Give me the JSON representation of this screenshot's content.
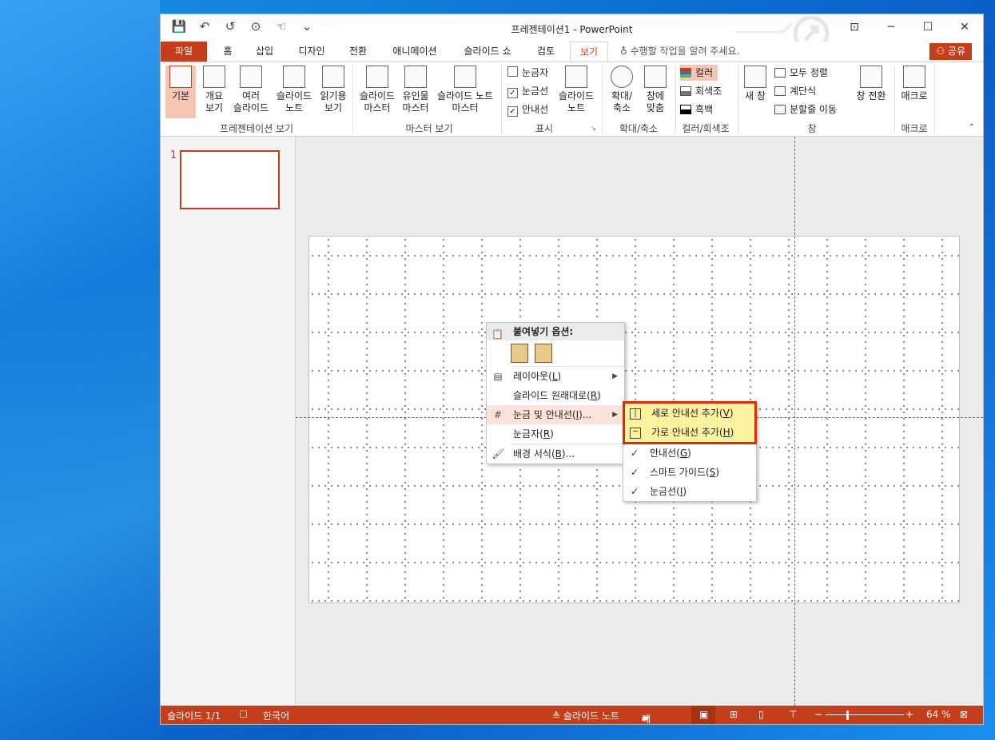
{
  "window": {
    "title": "프레젠테이션1 - PowerPoint"
  },
  "qat": {
    "save": "💾",
    "undo": "↶",
    "redo": "↺",
    "present": "⊙",
    "touch": "☜",
    "customize": "⌄"
  },
  "tabs": [
    {
      "label": "파일"
    },
    {
      "label": "홈"
    },
    {
      "label": "삽입"
    },
    {
      "label": "디자인"
    },
    {
      "label": "전환"
    },
    {
      "label": "애니메이션"
    },
    {
      "label": "슬라이드 쇼"
    },
    {
      "label": "검토"
    },
    {
      "label": "보기"
    }
  ],
  "tellme": "수행할 작업을 알려 주세요.",
  "share": "공유",
  "ribbon": {
    "presentation_views": {
      "label": "프레젠테이션 보기",
      "buttons": [
        "기본",
        "개요\n보기",
        "여러\n슬라이드",
        "슬라이드\n노트",
        "읽기용\n보기"
      ]
    },
    "master_views": {
      "label": "마스터 보기",
      "buttons": [
        "슬라이드\n마스터",
        "유인물\n마스터",
        "슬라이드 노트\n마스터"
      ]
    },
    "show": {
      "label": "표시",
      "checks": [
        "눈금자",
        "눈금선",
        "안내선"
      ],
      "notes": "슬라이드\n노트"
    },
    "zoom": {
      "label": "확대/축소",
      "buttons": [
        "확대/\n축소",
        "창에\n맞춤"
      ]
    },
    "color": {
      "label": "컬러/회색조",
      "items": [
        "컬러",
        "회색조",
        "흑백"
      ]
    },
    "window": {
      "label": "창",
      "new": "새 창",
      "items": [
        "모두 정렬",
        "계단식",
        "분할줄 이동"
      ]
    },
    "switch": "창 전환",
    "macro": {
      "label": "매크로",
      "button": "매크로"
    }
  },
  "thumbnails": {
    "number": "1"
  },
  "context_menu": {
    "paste_header": "붙여넣기 옵션:",
    "items": [
      {
        "text": "레이아웃(",
        "key": "L",
        "after": ")"
      },
      {
        "text": "슬라이드 원래대로(",
        "key": "R",
        "after": ")"
      },
      {
        "text": "눈금 및 안내선(",
        "key": "I",
        "after": ")..."
      },
      {
        "text": "눈금자(",
        "key": "R",
        "after": ")"
      },
      {
        "text": "배경 서식(",
        "key": "B",
        "after": ")..."
      }
    ]
  },
  "submenu": {
    "items": [
      {
        "text": "세로 안내선 추가(",
        "key": "V",
        "after": ")"
      },
      {
        "text": "가로 안내선 추가(",
        "key": "H",
        "after": ")"
      },
      {
        "text": "안내선(",
        "key": "G",
        "after": ")"
      },
      {
        "text": "스마트 가이드(",
        "key": "S",
        "after": ")"
      },
      {
        "text": "눈금선(",
        "key": "I",
        "after": ")"
      }
    ]
  },
  "status": {
    "slide": "슬라이드 1/1",
    "lang": "한국어",
    "notes": "≙ 슬라이드 노트",
    "comments": "메모",
    "zoom": "64 %"
  },
  "colors": {
    "accent": "#c43e1c",
    "highlight": "#e32b00"
  }
}
